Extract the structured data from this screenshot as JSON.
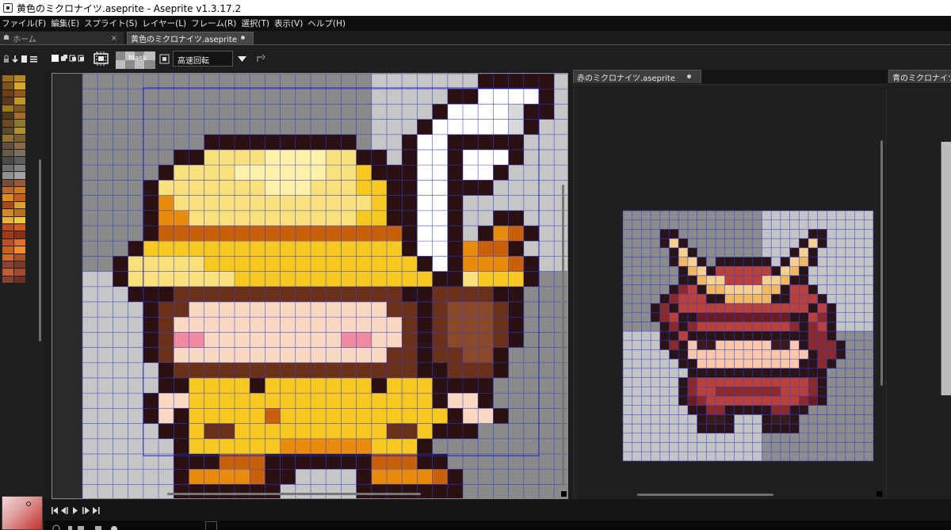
{
  "window": {
    "title": "黄色のミクロナイツ.aseprite - Aseprite v1.3.17.2"
  },
  "menu": {
    "items": [
      "ファイル(F)",
      "編集(E)",
      "スプライト(S)",
      "レイヤー(L)",
      "フレーム(R)",
      "選択(T)",
      "表示(V)",
      "ヘルプ(H)"
    ]
  },
  "tabs": {
    "home": "ホーム",
    "close_mark": "×",
    "active": "黄色のミクロナイツ.aseprite"
  },
  "toolbar": {
    "mask_label": "Mask",
    "rotation_algorithm": "高速回転"
  },
  "panes": {
    "red_tab": "赤のミクロナイツ.aseprite",
    "blue_tab": "青のミクロナイツ.aseprite"
  },
  "palette": {
    "colors": [
      "#9a6a1e",
      "#b8891f",
      "#7a5418",
      "#d9a82a",
      "#6d3d19",
      "#8f5a1c",
      "#5a3a1a",
      "#c2962a",
      "#a07818",
      "#7c5a20",
      "#4e3b1e",
      "#a86b2a",
      "#6b4b22",
      "#8b7a34",
      "#5b4b28",
      "#b0902c",
      "#917030",
      "#7a6030",
      "#605040",
      "#8a6a48",
      "#6a5a4a",
      "#7a7060",
      "#4a4a4a",
      "#5c5c5c",
      "#6e6e6e",
      "#808080",
      "#929292",
      "#a4a4a4",
      "#7a4a3a",
      "#9a5a3a",
      "#b86a30",
      "#d07a20",
      "#e08a18",
      "#c85a18",
      "#a84a1a",
      "#e0a030",
      "#d08828",
      "#b87020",
      "#e8b040",
      "#f0c848",
      "#c04a20",
      "#d85a20",
      "#a03a18",
      "#8a3018",
      "#b8502a",
      "#e07030",
      "#c86020",
      "#f08a30",
      "#d0682a",
      "#a85028",
      "#904030",
      "#7a3a2a",
      "#c05a38",
      "#a04a30",
      "#884030",
      "#6a3020"
    ],
    "fg_color": "#d8d8d8",
    "bg_color": "#c0302c"
  },
  "canvas": {
    "checker_light": "#c6c6c6",
    "checker_dark": "#8a8a8a",
    "grid_color": "#2f3bd6",
    "outline_color": "#2a1010"
  }
}
